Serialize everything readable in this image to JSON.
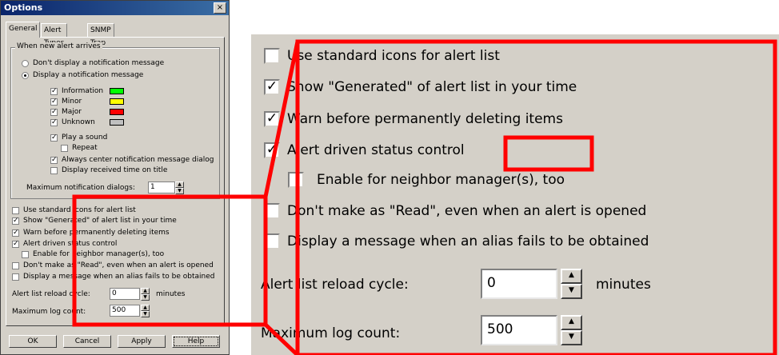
{
  "window": {
    "title": "Options",
    "close_glyph": "×"
  },
  "tabs": [
    "General",
    "Alert Types",
    "SNMP Trap"
  ],
  "group": {
    "title": "When new alert arrives",
    "radio_dont": "Don't display a notification message",
    "radio_display": "Display a notification message",
    "levels": [
      {
        "label": "Information",
        "color": "#00ff00"
      },
      {
        "label": "Minor",
        "color": "#ffff00"
      },
      {
        "label": "Major",
        "color": "#ff0000"
      },
      {
        "label": "Unknown",
        "color": "#c0c0c0"
      }
    ],
    "play_sound": "Play a  sound",
    "repeat": "Repeat",
    "always_center": "Always center notification message dialog",
    "display_time": "Display received time on title",
    "max_dialogs_label": "Maximum notification dialogs:",
    "max_dialogs_value": "1"
  },
  "options": [
    "Use standard icons for alert list",
    "Show \"Generated\" of alert list in your time",
    "Warn before permanently deleting items",
    "Alert driven status control",
    "Enable for neighbor manager(s), too",
    "Don't make as \"Read\", even when an alert is opened",
    "Display a message when an alias fails to be obtained"
  ],
  "reload": {
    "label": "Alert list reload cycle:",
    "value": "0",
    "unit": "minutes"
  },
  "maxlog": {
    "label": "Maximum log count:",
    "value": "500"
  },
  "buttons": {
    "ok": "OK",
    "cancel": "Cancel",
    "apply": "Apply",
    "help": "Help"
  },
  "zoom": {
    "options": [
      "Use standard icons for alert list",
      "Show \"Generated\" of alert list in your time",
      "Warn before permanently deleting items",
      "Alert driven status control",
      "Enable for neighbor manager(s), too",
      "Don't make as \"Read\", even when an alert is opened",
      "Display a message when an alias fails to be obtained"
    ],
    "reload_label": "Alert list reload cycle:",
    "reload_value": "0",
    "reload_unit": "minutes",
    "maxlog_label": "Maximum log count:",
    "maxlog_value": "500"
  },
  "colors": {
    "highlight": "#ff0000",
    "face": "#d4d0c8",
    "title": "#0a246a"
  },
  "glyphs": {
    "check": "✓",
    "up": "▲",
    "down": "▼"
  }
}
